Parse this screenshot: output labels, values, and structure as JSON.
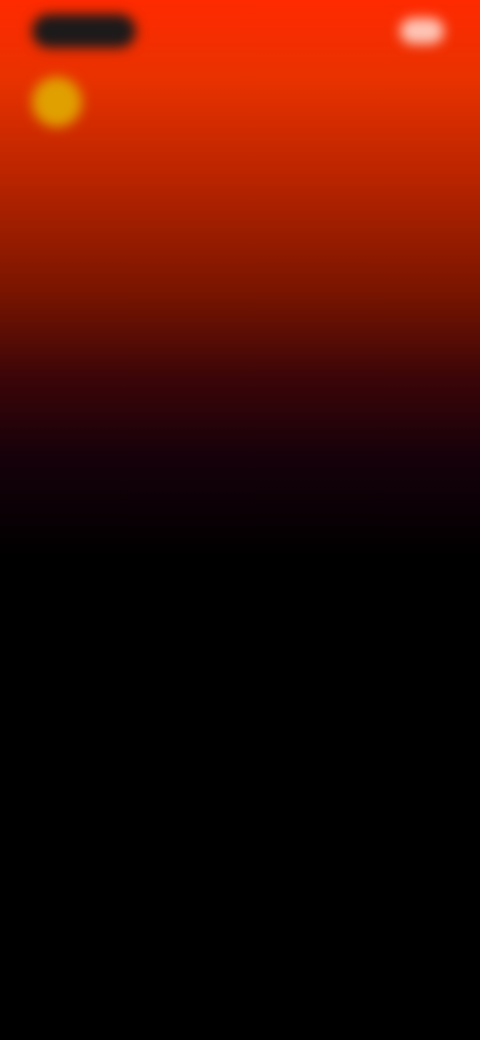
{
  "header": {
    "logo_text": "",
    "right_text": "",
    "right_button_label": ""
  },
  "banner": {
    "title": "",
    "subtitle": ""
  },
  "tag_line": "",
  "hero": {
    "title": "",
    "subtitle": ""
  },
  "colors": {
    "gradient_top": "#ff2a00",
    "gradient_mid": "#7a1500",
    "background": "#000000",
    "avatar": "#e0a000",
    "logo_pill": "#1c1a1a"
  }
}
